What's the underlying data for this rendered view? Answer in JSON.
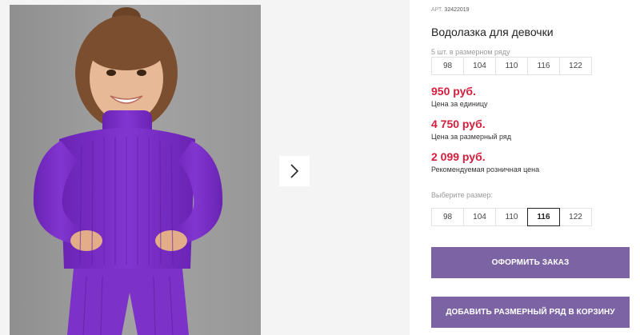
{
  "gallery": {
    "next_icon": "chevron-right-icon"
  },
  "product": {
    "article_label": "АРТ.",
    "article_number": "32422019",
    "title": "Водолазка для девочки",
    "size_row_caption": "5 шт. в размерном ряду",
    "size_row": [
      "98",
      "104",
      "110",
      "116",
      "122"
    ],
    "prices": [
      {
        "value": "950 руб.",
        "label": "Цена за единицу"
      },
      {
        "value": "4 750 руб.",
        "label": "Цена за размерный ряд"
      },
      {
        "value": "2 099 руб.",
        "label": "Рекомендуемая розничная цена"
      }
    ],
    "choose_size_label": "Выберите размер:",
    "size_options": [
      "98",
      "104",
      "110",
      "116",
      "122"
    ],
    "selected_size": "116",
    "order_button": "ОФОРМИТЬ ЗАКАЗ",
    "add_to_cart_button": "ДОБАВИТЬ РАЗМЕРНЫЙ РЯД В КОРЗИНУ"
  },
  "colors": {
    "price": "#d41e3c",
    "button": "#7b63a4",
    "sweater": "#7a2fc4"
  }
}
